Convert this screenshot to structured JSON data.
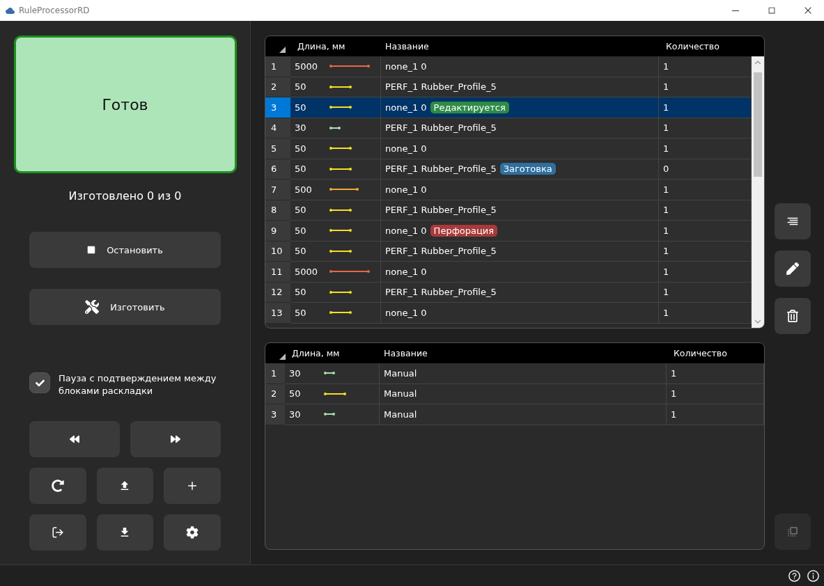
{
  "window": {
    "title": "RuleProcessorRD"
  },
  "status_card": {
    "label": "Готов"
  },
  "produced": "Изготовлено 0 из 0",
  "actions": [
    {
      "label": "Остановить",
      "kind": "stop"
    },
    {
      "label": "Изготовить",
      "kind": "make"
    }
  ],
  "pause_option": {
    "label": "Пауза с подтверждением между блоками раскладки",
    "checked": true
  },
  "nav_buttons": [
    {
      "kind": "rewind"
    },
    {
      "kind": "forward"
    }
  ],
  "tool_buttons": [
    {
      "kind": "refresh"
    },
    {
      "kind": "upload"
    },
    {
      "kind": "add"
    },
    {
      "kind": "exit"
    },
    {
      "kind": "download"
    },
    {
      "kind": "settings"
    }
  ],
  "side_buttons": [
    {
      "kind": "align",
      "disabled": false
    },
    {
      "kind": "edit",
      "disabled": false
    },
    {
      "kind": "delete",
      "disabled": false
    },
    {
      "kind": "swap",
      "disabled": true
    }
  ],
  "main_table": {
    "columns": [
      "Длина, мм",
      "Название",
      "Количество"
    ],
    "rows": [
      {
        "num": "1",
        "length": "5000",
        "bar": {
          "color": "#e8664a",
          "kind": "long"
        },
        "name": "none_1 0",
        "qty": "1",
        "selected": false
      },
      {
        "num": "2",
        "length": "50",
        "bar": {
          "color": "#f5e020",
          "kind": "short"
        },
        "name": "PERF_1 Rubber_Profile_5",
        "qty": "1",
        "selected": false
      },
      {
        "num": "3",
        "length": "50",
        "bar": {
          "color": "#f5e020",
          "kind": "short"
        },
        "name": "none_1 0",
        "tag": {
          "label": "Редактируется",
          "color": "#2e8b47"
        },
        "qty": "1",
        "selected": true
      },
      {
        "num": "4",
        "length": "30",
        "bar": {
          "color": "#a8e0a8",
          "kind": "tiny"
        },
        "name": "PERF_1 Rubber_Profile_5",
        "qty": "1",
        "selected": false
      },
      {
        "num": "5",
        "length": "50",
        "bar": {
          "color": "#f5e020",
          "kind": "short"
        },
        "name": "none_1 0",
        "qty": "1",
        "selected": false
      },
      {
        "num": "6",
        "length": "50",
        "bar": {
          "color": "#f5e020",
          "kind": "short"
        },
        "name": "PERF_1 Rubber_Profile_5",
        "tag": {
          "label": "Заготовка",
          "color": "#2f6f9f"
        },
        "qty": "0",
        "selected": false
      },
      {
        "num": "7",
        "length": "500",
        "bar": {
          "color": "#f0a830",
          "kind": "medium"
        },
        "name": "none_1 0",
        "qty": "1",
        "selected": false
      },
      {
        "num": "8",
        "length": "50",
        "bar": {
          "color": "#f5e020",
          "kind": "short"
        },
        "name": "PERF_1 Rubber_Profile_5",
        "qty": "1",
        "selected": false
      },
      {
        "num": "9",
        "length": "50",
        "bar": {
          "color": "#f5e020",
          "kind": "short"
        },
        "name": "none_1 0",
        "tag": {
          "label": "Перфорация",
          "color": "#a83a3a"
        },
        "qty": "1",
        "selected": false
      },
      {
        "num": "10",
        "length": "50",
        "bar": {
          "color": "#f5e020",
          "kind": "short"
        },
        "name": "PERF_1 Rubber_Profile_5",
        "qty": "1",
        "selected": false
      },
      {
        "num": "11",
        "length": "5000",
        "bar": {
          "color": "#e8664a",
          "kind": "long"
        },
        "name": "none_1 0",
        "qty": "1",
        "selected": false
      },
      {
        "num": "12",
        "length": "50",
        "bar": {
          "color": "#f5e020",
          "kind": "short"
        },
        "name": "PERF_1 Rubber_Profile_5",
        "qty": "1",
        "selected": false
      },
      {
        "num": "13",
        "length": "50",
        "bar": {
          "color": "#f5e020",
          "kind": "short"
        },
        "name": "none_1 0",
        "qty": "1",
        "selected": false
      }
    ]
  },
  "manual_table": {
    "columns": [
      "Длина, мм",
      "Название",
      "Количество"
    ],
    "rows": [
      {
        "num": "1",
        "length": "30",
        "bar": {
          "color": "#a8e0a8",
          "kind": "tiny"
        },
        "name": "Manual",
        "qty": "1"
      },
      {
        "num": "2",
        "length": "50",
        "bar": {
          "color": "#f5e020",
          "kind": "short"
        },
        "name": "Manual",
        "qty": "1"
      },
      {
        "num": "3",
        "length": "30",
        "bar": {
          "color": "#a8e0a8",
          "kind": "tiny"
        },
        "name": "Manual",
        "qty": "1"
      }
    ]
  }
}
